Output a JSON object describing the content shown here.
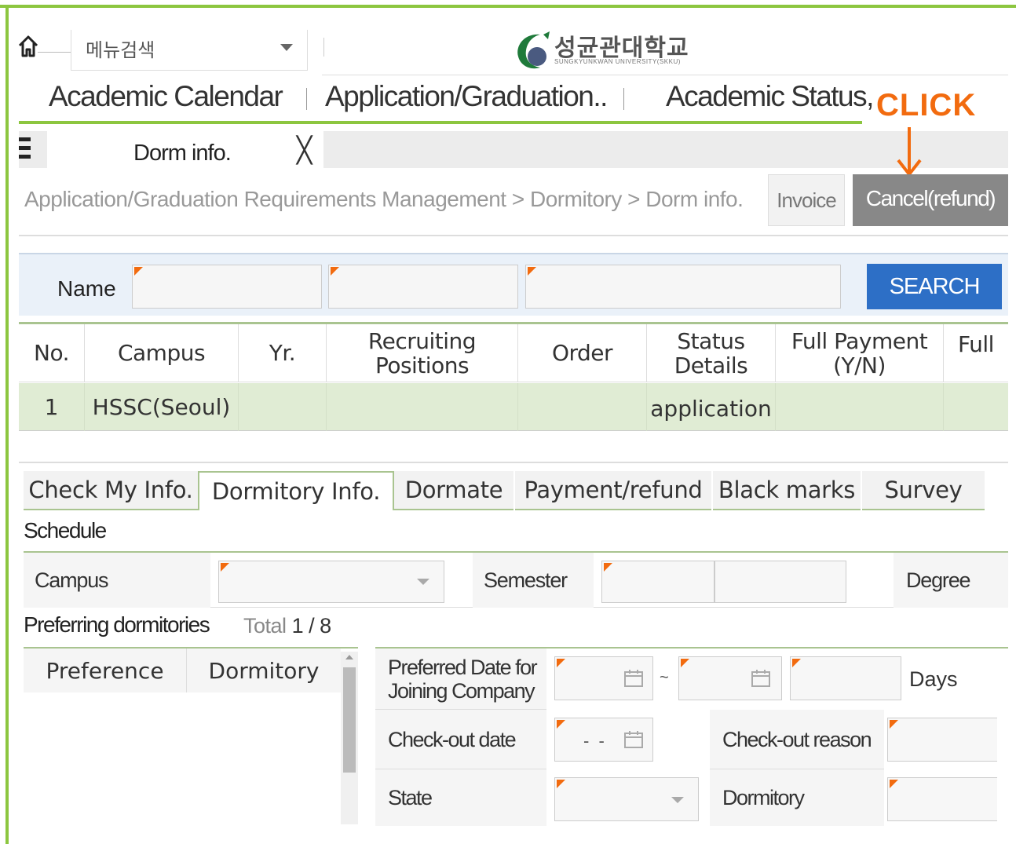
{
  "topbar": {
    "menu_search_label": "메뉴검색",
    "logo_name": "성균관대학교",
    "logo_sub": "SUNGKYUNKWAN UNIVERSITY(SKKU)"
  },
  "main_nav": [
    {
      "label": "Academic Calendar"
    },
    {
      "label": "Application/Graduation.."
    },
    {
      "label": "Academic Status,"
    }
  ],
  "annotation": {
    "label": "CLICK",
    "color": "#f26b0f"
  },
  "doc_tab": {
    "label": "Dorm info.",
    "close": "╳"
  },
  "breadcrumb": "Application/Graduation Requirements Management > Dormitory > Dorm info.",
  "actions": {
    "invoice": "Invoice",
    "cancel": "Cancel(refund)"
  },
  "search": {
    "name_label": "Name",
    "button": "SEARCH"
  },
  "grid": {
    "headers": [
      "No.",
      "Campus",
      "Yr.",
      "Recruiting Positions",
      "Order",
      "Status Details",
      "Full Payment (Y/N)",
      "Full"
    ],
    "rows": [
      {
        "no": "1",
        "campus": "HSSC(Seoul)",
        "yr": "",
        "recruiting": "",
        "order": "",
        "status": "application",
        "full_payment": "",
        "full": ""
      }
    ]
  },
  "sub_tabs": [
    "Check My Info.",
    "Dormitory Info.",
    "Dormate",
    "Payment/refund",
    "Black marks",
    "Survey"
  ],
  "schedule": {
    "title": "Schedule",
    "campus_label": "Campus",
    "semester_label": "Semester",
    "degree_label": "Degree"
  },
  "preferring": {
    "title": "Preferring dormitories",
    "total_label": "Total",
    "total_value": "1 / 8",
    "col_preference": "Preference",
    "col_dormitory": "Dormitory"
  },
  "details": {
    "preferred_date_label": "Preferred Date for Joining Company",
    "tilde": "~",
    "days_label": "Days",
    "checkout_date_label": "Check-out date",
    "checkout_date_value": "- -",
    "checkout_reason_label": "Check-out reason",
    "state_label": "State",
    "dormitory_label": "Dormitory"
  },
  "colors": {
    "accent_green": "#8cc63f",
    "search_blue": "#2d6fc6",
    "required_orange": "#f26b0f",
    "selected_row": "#e0ecd4"
  }
}
